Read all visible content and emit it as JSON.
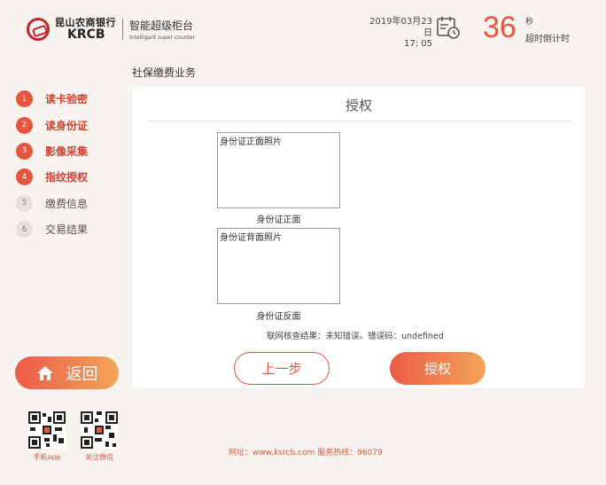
{
  "header": {
    "bank_name_cn": "昆山农商银行",
    "bank_name_en": "KRCB",
    "product_cn": "智能超级柜台",
    "product_en": "Intelligent super counter",
    "date": "2019年03月23日",
    "time": "17: 05",
    "countdown_value": "36",
    "countdown_unit": "秒",
    "countdown_label": "超时倒计时"
  },
  "business_title": "社保缴费业务",
  "steps": [
    {
      "num": "1",
      "label": "读卡验密",
      "active": true
    },
    {
      "num": "2",
      "label": "读身份证",
      "active": true
    },
    {
      "num": "3",
      "label": "影像采集",
      "active": true
    },
    {
      "num": "4",
      "label": "指纹授权",
      "active": true
    },
    {
      "num": "5",
      "label": "缴费信息",
      "active": false
    },
    {
      "num": "6",
      "label": "交易结果",
      "active": false
    }
  ],
  "back_button": {
    "label": "返回"
  },
  "panel": {
    "title": "授权",
    "front_photo_alt": "身份证正面照片",
    "front_caption": "身份证正面",
    "back_photo_alt": "身份证背面照片",
    "back_caption": "身份证反面",
    "result_text": "联网核查结果：未知错误。错误码：undefined",
    "prev_button": "上一步",
    "auth_button": "授权"
  },
  "footer": {
    "qr_app_caption": "手机app",
    "qr_wechat_caption": "关注微信",
    "info": "网址：www.ksrcb.com 服务热线：96079"
  },
  "colors": {
    "accent": "#e7553f",
    "accent_gradient_end": "#f3a557",
    "background": "#f7f4ef"
  }
}
